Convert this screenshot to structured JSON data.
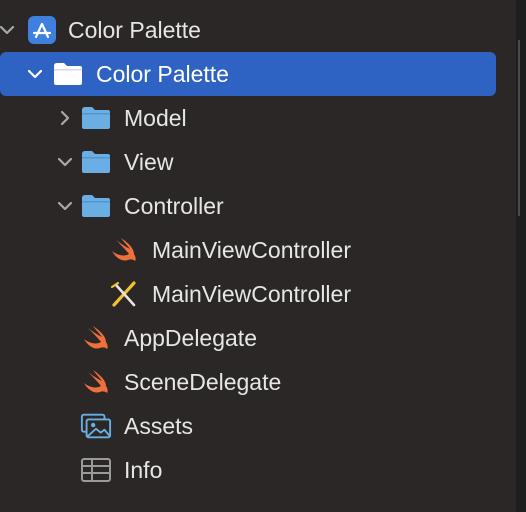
{
  "navigator": {
    "items": [
      {
        "label": "Color Palette",
        "icon": "xcode-project-icon",
        "disclosure": "expanded"
      },
      {
        "label": "Color Palette",
        "icon": "folder-icon",
        "disclosure": "expanded",
        "selected": true
      },
      {
        "label": "Model",
        "icon": "folder-icon",
        "disclosure": "collapsed"
      },
      {
        "label": "View",
        "icon": "folder-icon",
        "disclosure": "expanded"
      },
      {
        "label": "Controller",
        "icon": "folder-icon",
        "disclosure": "expanded"
      },
      {
        "label": "MainViewController",
        "icon": "swift-file-icon"
      },
      {
        "label": "MainViewController",
        "icon": "interface-builder-icon"
      },
      {
        "label": "AppDelegate",
        "icon": "swift-file-icon"
      },
      {
        "label": "SceneDelegate",
        "icon": "swift-file-icon"
      },
      {
        "label": "Assets",
        "icon": "asset-catalog-icon"
      },
      {
        "label": "Info",
        "icon": "plist-icon"
      }
    ]
  },
  "colors": {
    "background": "#2b2727",
    "selection": "#2f63c3",
    "folder": "#6aaee3",
    "swift": "#f0703c",
    "text": "#e6e6e6"
  }
}
